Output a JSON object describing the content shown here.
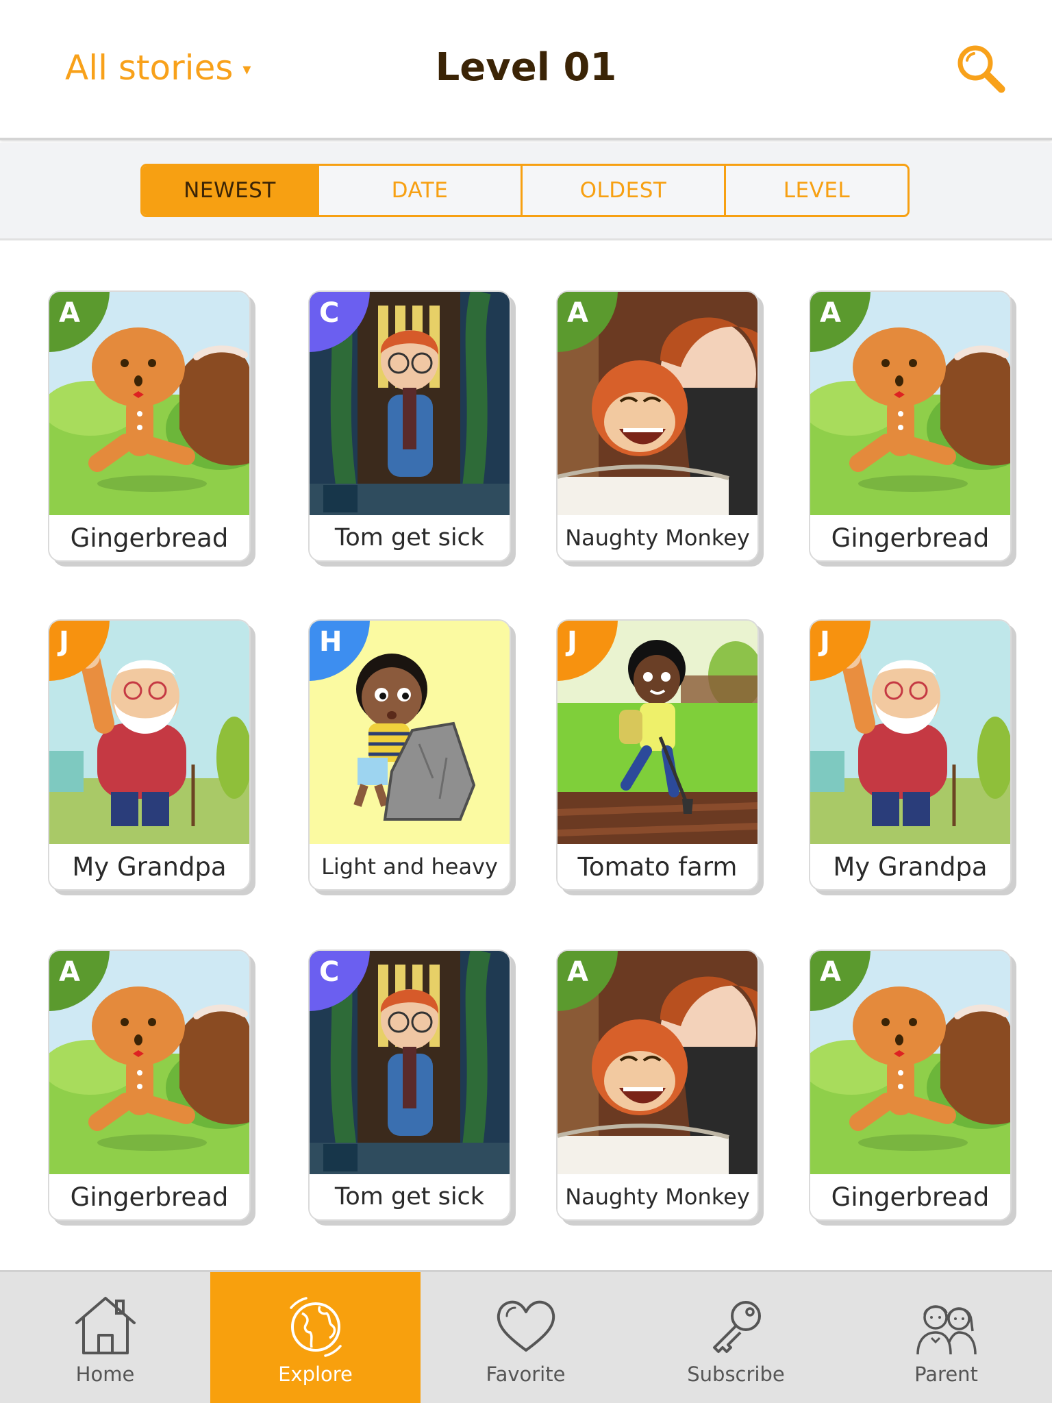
{
  "header": {
    "filter_label": "All stories",
    "filter_caret": "▾",
    "title": "Level 01",
    "search_icon": "search-icon"
  },
  "sort_tabs": [
    {
      "label": "NEWEST",
      "active": true
    },
    {
      "label": "DATE",
      "active": false
    },
    {
      "label": "OLDEST",
      "active": false
    },
    {
      "label": "LEVEL",
      "active": false
    }
  ],
  "stories": [
    {
      "title": "Gingerbread",
      "level": "A",
      "badge_color": "#5b9a2e",
      "art": "gingerbread"
    },
    {
      "title": "Tom get sick",
      "level": "C",
      "badge_color": "#6b5ff0",
      "art": "tom"
    },
    {
      "title": "Naughty Monkey",
      "level": "A",
      "badge_color": "#5b9a2e",
      "art": "monkey"
    },
    {
      "title": "Gingerbread",
      "level": "A",
      "badge_color": "#5b9a2e",
      "art": "gingerbread"
    },
    {
      "title": "My Grandpa",
      "level": "J",
      "badge_color": "#f7920f",
      "art": "grandpa"
    },
    {
      "title": "Light and heavy",
      "level": "H",
      "badge_color": "#3d8ef0",
      "art": "rock"
    },
    {
      "title": "Tomato farm",
      "level": "J",
      "badge_color": "#f7920f",
      "art": "farm"
    },
    {
      "title": "My Grandpa",
      "level": "J",
      "badge_color": "#f7920f",
      "art": "grandpa"
    },
    {
      "title": "Gingerbread",
      "level": "A",
      "badge_color": "#5b9a2e",
      "art": "gingerbread"
    },
    {
      "title": "Tom get sick",
      "level": "C",
      "badge_color": "#6b5ff0",
      "art": "tom"
    },
    {
      "title": "Naughty Monkey",
      "level": "A",
      "badge_color": "#5b9a2e",
      "art": "monkey"
    },
    {
      "title": "Gingerbread",
      "level": "A",
      "badge_color": "#5b9a2e",
      "art": "gingerbread"
    }
  ],
  "bottom_nav": [
    {
      "label": "Home",
      "icon": "home-icon",
      "active": false
    },
    {
      "label": "Explore",
      "icon": "globe-icon",
      "active": true
    },
    {
      "label": "Favorite",
      "icon": "heart-icon",
      "active": false
    },
    {
      "label": "Subscribe",
      "icon": "key-icon",
      "active": false
    },
    {
      "label": "Parent",
      "icon": "parents-icon",
      "active": false
    }
  ],
  "colors": {
    "accent": "#f8a11a",
    "title_text": "#3b2406",
    "nav_background": "#e2e2e2",
    "nav_active": "#f8a00d"
  }
}
